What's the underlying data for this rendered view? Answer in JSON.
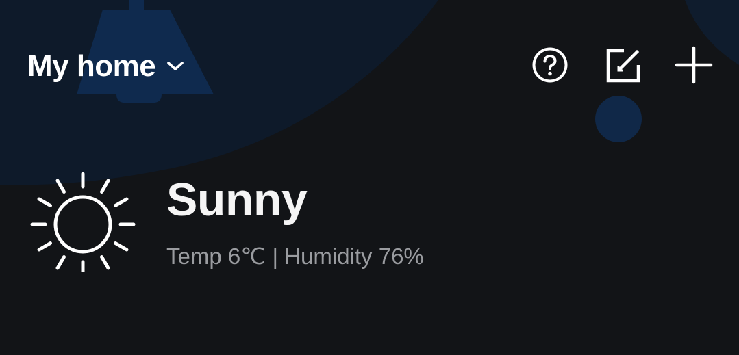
{
  "header": {
    "home_label": "My home",
    "actions": [
      {
        "icon": "help-circle-icon"
      },
      {
        "icon": "edit-icon"
      },
      {
        "icon": "plus-icon"
      }
    ]
  },
  "weather": {
    "icon": "sun-icon",
    "condition": "Sunny",
    "details": "Temp 6℃ | Humidity 76%"
  },
  "colors": {
    "background": "#121417",
    "header_background": "#0e1a2a",
    "decoration_blue": "#0f2a4e",
    "text_primary": "#ffffff",
    "text_secondary": "#9a9ca0"
  }
}
